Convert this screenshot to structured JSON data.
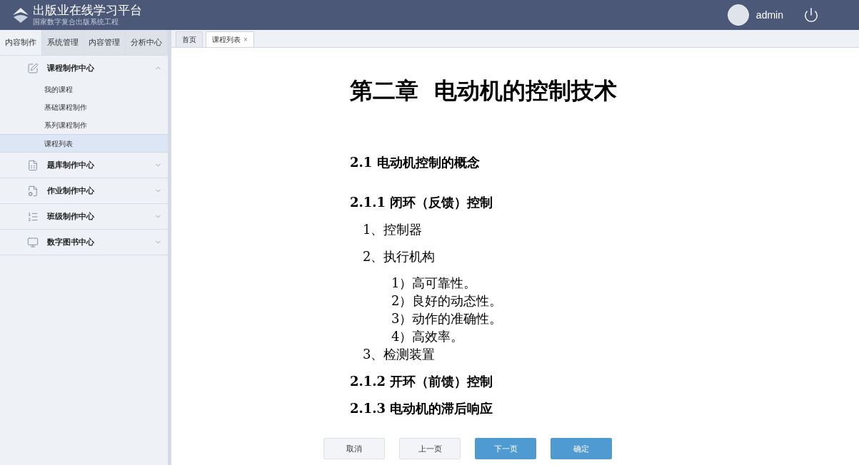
{
  "header": {
    "logo_title": "出版业在线学习平台",
    "logo_subtitle": "国家数字复合出版系统工程",
    "user": "admin"
  },
  "sidebar": {
    "tabs": [
      {
        "label": "内容制作",
        "selected": true
      },
      {
        "label": "系统管理",
        "selected": false
      },
      {
        "label": "内容管理",
        "selected": false
      },
      {
        "label": "分析中心",
        "selected": false
      }
    ],
    "groups": [
      {
        "label": "课程制作中心",
        "expanded": true,
        "children": [
          {
            "label": "我的课程",
            "selected": false
          },
          {
            "label": "基础课程制作",
            "selected": false
          },
          {
            "label": "系列课程制作",
            "selected": false
          },
          {
            "label": "课程列表",
            "selected": true
          }
        ]
      },
      {
        "label": "题库制作中心",
        "expanded": false
      },
      {
        "label": "作业制作中心",
        "expanded": false
      },
      {
        "label": "班级制作中心",
        "expanded": false
      },
      {
        "label": "数字图书中心",
        "expanded": false
      }
    ]
  },
  "content_tabs": [
    {
      "label": "首页",
      "selected": false
    },
    {
      "label": "课程列表",
      "selected": true,
      "close": "×"
    }
  ],
  "document": [
    {
      "kind": "title",
      "text": "第二章  电动机的控制技术"
    },
    {
      "kind": "section",
      "text": "2.1 电动机控制的概念"
    },
    {
      "kind": "subsection",
      "text": "2.1.1 闭环（反馈）控制"
    },
    {
      "kind": "item",
      "text": "1、控制器"
    },
    {
      "kind": "item",
      "text": "2、执行机构"
    },
    {
      "kind": "subitem",
      "text": "1）高可靠性。"
    },
    {
      "kind": "subitem",
      "text": "2）良好的动态性。"
    },
    {
      "kind": "subitem",
      "text": "3）动作的准确性。"
    },
    {
      "kind": "subitem",
      "text": "4）高效率。"
    },
    {
      "kind": "item2",
      "text": "3、检测装置"
    },
    {
      "kind": "subsection",
      "text": "2.1.2 开环（前馈）控制"
    },
    {
      "kind": "subsection",
      "text": "2.1.3 电动机的滞后响应"
    }
  ],
  "buttons": [
    {
      "label": "取消",
      "kind": "secondary"
    },
    {
      "label": "上一页",
      "kind": "secondary"
    },
    {
      "label": "下一页",
      "kind": "primary"
    },
    {
      "label": "确定",
      "kind": "primary"
    }
  ]
}
